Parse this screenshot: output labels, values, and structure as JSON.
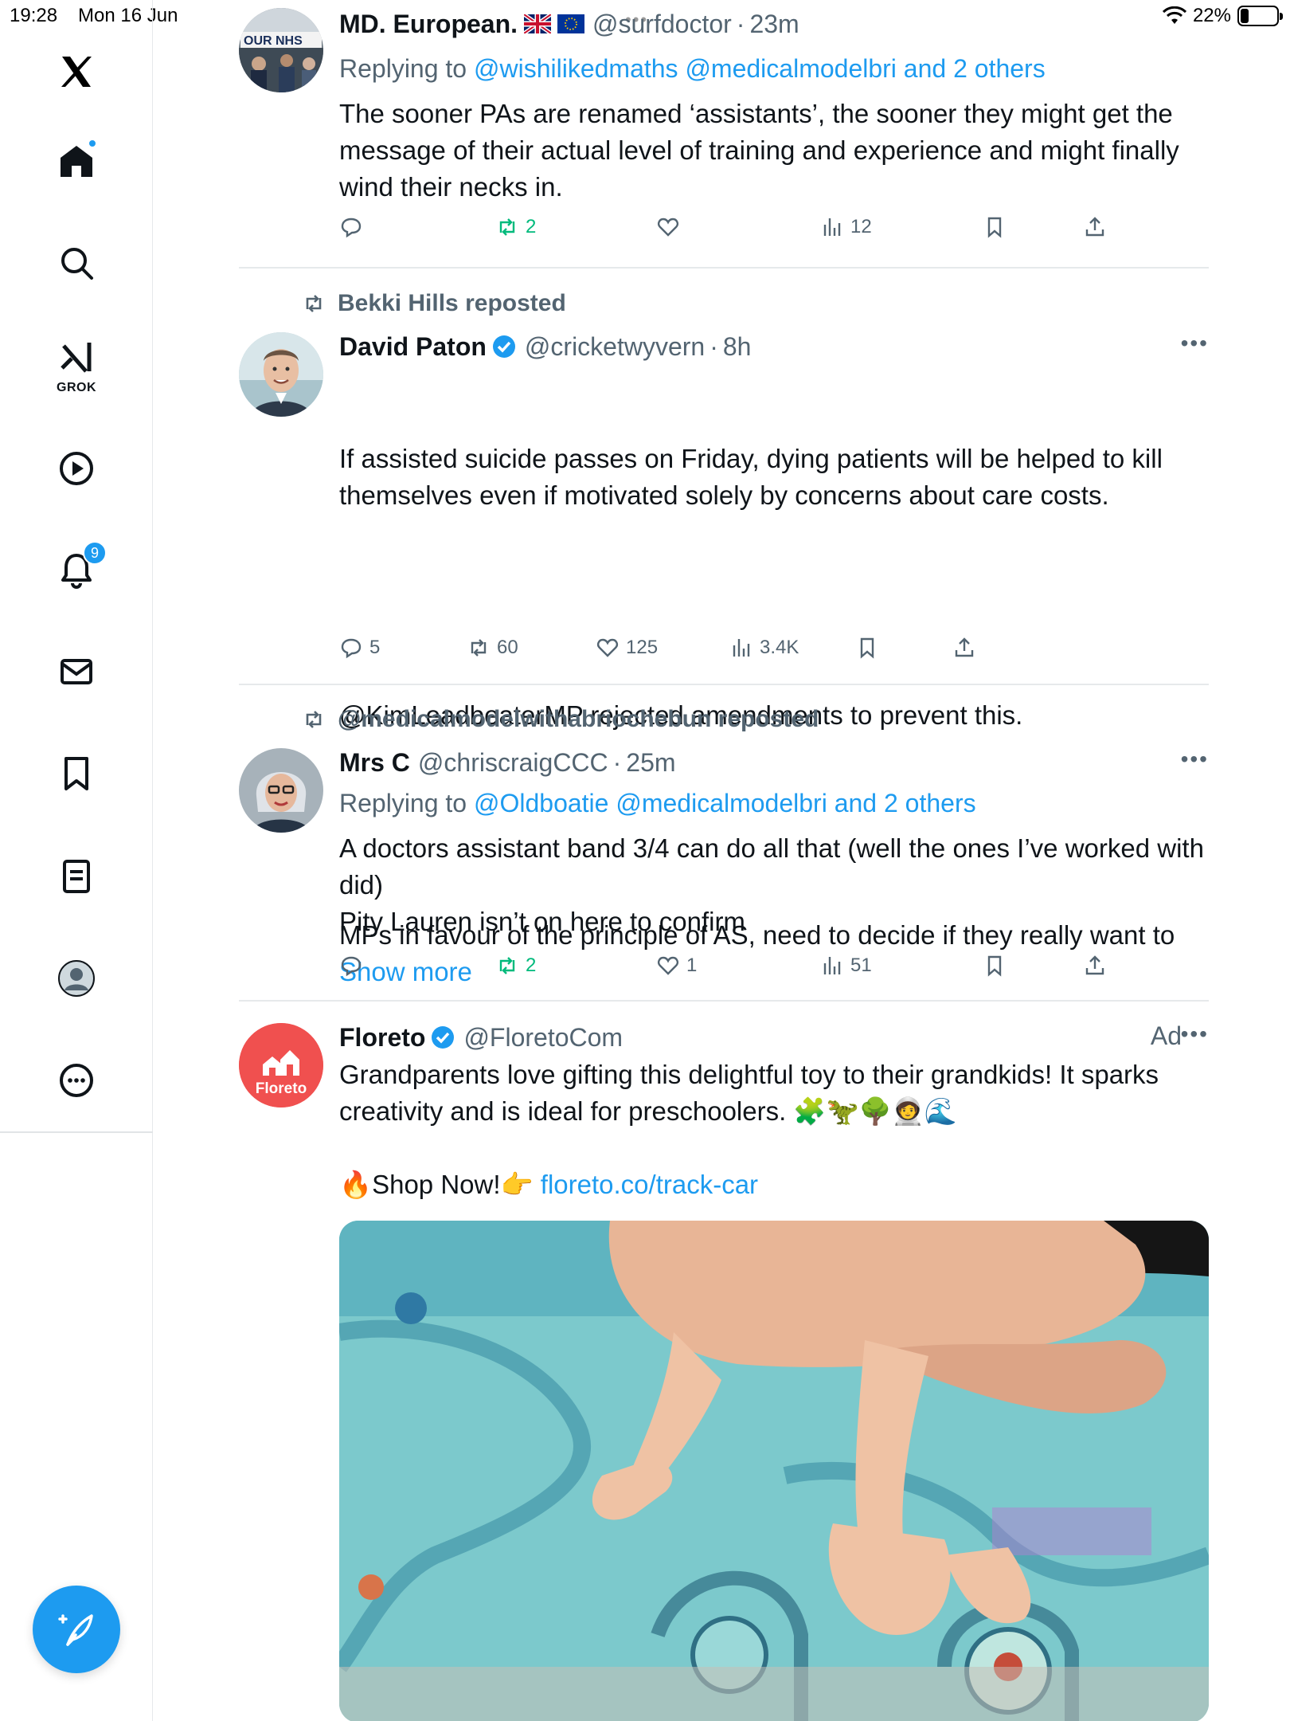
{
  "status_bar": {
    "time": "19:28",
    "date": "Mon 16 Jun",
    "battery": "22%",
    "battery_level": 0.22
  },
  "sidebar": {
    "items": [
      {
        "name": "home",
        "icon": "home-icon",
        "notification_dot": true
      },
      {
        "name": "explore",
        "icon": "search-icon"
      },
      {
        "name": "grok",
        "icon": "grok-icon",
        "label": "GROK"
      },
      {
        "name": "videos",
        "icon": "play-icon"
      },
      {
        "name": "notifications",
        "icon": "bell-icon",
        "badge": "9"
      },
      {
        "name": "messages",
        "icon": "mail-icon"
      },
      {
        "name": "bookmarks",
        "icon": "bookmark-icon"
      },
      {
        "name": "lists",
        "icon": "list-icon"
      },
      {
        "name": "profile",
        "icon": "profile-icon"
      },
      {
        "name": "more",
        "icon": "more-icon"
      }
    ],
    "compose": {
      "icon": "compose-icon"
    }
  },
  "tweets": [
    {
      "name": "MD. European.",
      "handle": "@surfdoctor",
      "time": "23m",
      "flags": [
        "uk-flag-icon",
        "eu-flag-icon"
      ],
      "replying_prefix": "Replying to",
      "replying_to": "@wishilikedmaths @medicalmodelbri and 2 others",
      "body": "The sooner PAs are renamed ‘assistants’, the sooner they might get the message of their actual level of training and experience and might finally wind their necks in.",
      "stats": {
        "replies": "",
        "reposts": "2",
        "likes": "",
        "views": "12"
      },
      "avatar_text": "OUR NHS"
    },
    {
      "repost_by": "Bekki Hills reposted",
      "name": "David Paton",
      "verified": true,
      "handle": "@cricketwyvern",
      "time": "8h",
      "body_1": "If assisted suicide passes on Friday, dying patients will be helped to kill themselves even if motivated solely by concerns about care costs.",
      "body_2": "@KimLeadbeaterMP rejected amendments to prevent this.",
      "body_3": "MPs in favour of the principle of AS, need to decide if they really want to",
      "show_more": "Show more",
      "stats": {
        "replies": "5",
        "reposts": "60",
        "likes": "125",
        "views": "3.4K"
      }
    },
    {
      "repost_by": "@medicalmodelwithabriochebun reposted",
      "name": "Mrs C",
      "handle": "@chriscraigCCC",
      "time": "25m",
      "replying_prefix": "Replying to",
      "replying_to": "@Oldboatie @medicalmodelbri and 2 others",
      "body": "A doctors assistant band 3/4 can do all that (well the ones I’ve worked with did)\nPity Lauren isn’t on here to confirm",
      "stats": {
        "replies": "",
        "reposts": "2",
        "likes": "1",
        "views": "51"
      }
    },
    {
      "name": "Floreto",
      "verified": true,
      "handle": "@FloretoCom",
      "ad_label": "Ad",
      "avatar_text": "Floreto",
      "body": "Grandparents love gifting this delightful toy to their grandkids! It sparks creativity and is ideal for preschoolers. 🧩🦖🌳🧑‍🚀🌊",
      "cta": "🔥Shop Now!👉",
      "cta_link": "floreto.co/track-car"
    }
  ],
  "colors": {
    "accent": "#1d9bf0",
    "repost_green": "#00ba7c",
    "muted": "#536471"
  }
}
